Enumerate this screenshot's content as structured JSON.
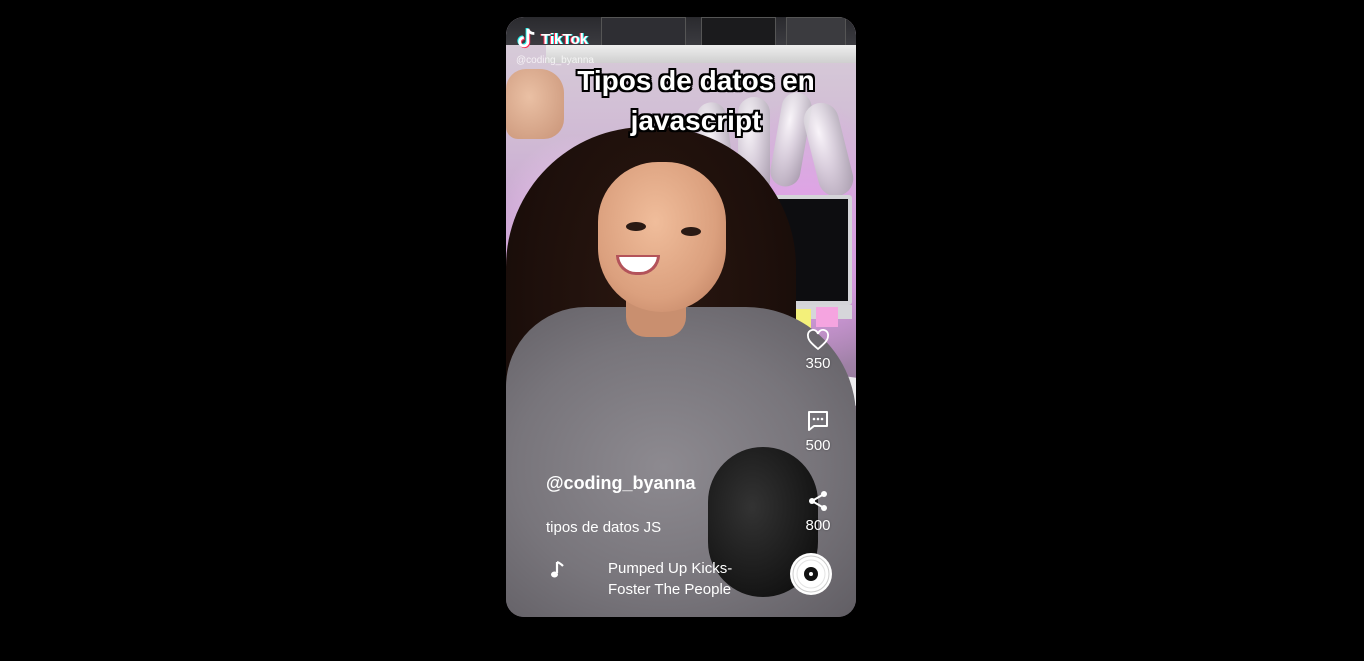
{
  "app": {
    "logo_text": "TikTok",
    "watermark_user": "@coding_byanna"
  },
  "video": {
    "caption": "Tipos de datos en javascript",
    "username": "@coding_byanna",
    "description": "tipos de datos JS",
    "song": "Pumped Up Kicks- Foster The People"
  },
  "actions": {
    "likes": "350",
    "comments": "500",
    "shares": "800"
  },
  "icons": {
    "like": "heart-outline-icon",
    "comment": "comment-icon",
    "share": "share-icon",
    "music": "music-note-icon",
    "disc": "vinyl-disc-icon"
  },
  "colors": {
    "tiktok_cyan": "#25f4ee",
    "tiktok_red": "#fe2c55",
    "background": "#000000"
  }
}
